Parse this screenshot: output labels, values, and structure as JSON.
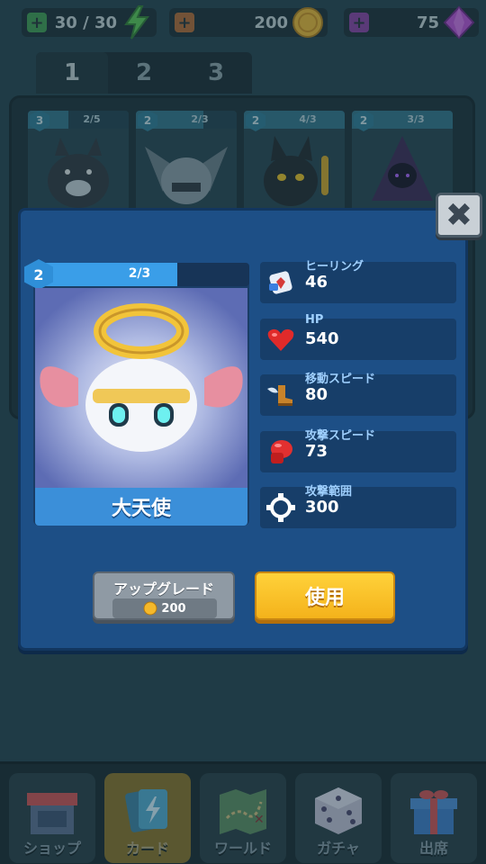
{
  "resources": {
    "energy": {
      "value": "30 / 30",
      "icon": "lightning-icon",
      "color": "#3c9a4a"
    },
    "coins": {
      "value": "200",
      "icon": "coin-icon",
      "color": "#b7652b"
    },
    "gems": {
      "value": "75",
      "icon": "gem-icon",
      "color": "#8a3aa0"
    }
  },
  "deck_tabs": [
    {
      "label": "1",
      "active": true
    },
    {
      "label": "2",
      "active": false
    },
    {
      "label": "3",
      "active": false
    }
  ],
  "deck_slots": [
    {
      "level": "3",
      "progress": "2/5",
      "fill": 0.4,
      "creature": "wolf"
    },
    {
      "level": "2",
      "progress": "2/3",
      "fill": 0.67,
      "creature": "gargoyle"
    },
    {
      "level": "2",
      "progress": "4/3",
      "fill": 1.0,
      "creature": "black-cat"
    },
    {
      "level": "2",
      "progress": "3/3",
      "fill": 1.0,
      "creature": "hooded-mage"
    }
  ],
  "unit": {
    "name": "大天使",
    "level": "2",
    "progress": "2/3",
    "fill": 0.67
  },
  "stats": {
    "heal": {
      "label": "ヒーリング",
      "value": "46",
      "icon": "healing-icon"
    },
    "hp": {
      "label": "HP",
      "value": "540",
      "icon": "heart-icon"
    },
    "move": {
      "label": "移動スピード",
      "value": "80",
      "icon": "winged-boot-icon"
    },
    "atkspd": {
      "label": "攻撃スピード",
      "value": "73",
      "icon": "boxing-glove-icon"
    },
    "range": {
      "label": "攻撃範囲",
      "value": "300",
      "icon": "range-icon"
    }
  },
  "upgrade": {
    "label": "アップグレード",
    "cost": "200"
  },
  "use": {
    "label": "使用"
  },
  "close": {
    "label": "✖"
  },
  "nav": [
    {
      "label": "ショップ",
      "icon": "shop-icon",
      "active": false
    },
    {
      "label": "カード",
      "icon": "cards-icon",
      "active": true
    },
    {
      "label": "ワールド",
      "icon": "map-icon",
      "active": false
    },
    {
      "label": "ガチャ",
      "icon": "dice-icon",
      "active": false
    },
    {
      "label": "出席",
      "icon": "gift-icon",
      "active": false
    }
  ]
}
